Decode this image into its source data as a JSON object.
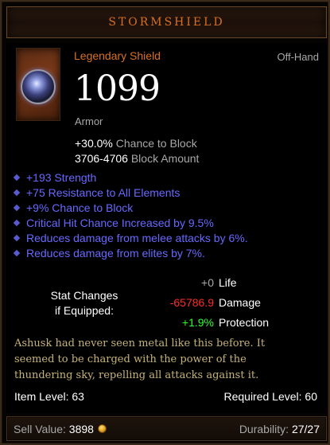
{
  "header": {
    "title": "STORMSHIELD"
  },
  "item": {
    "rarity_type": "Legendary Shield",
    "slot": "Off-Hand",
    "armor_value": "1099",
    "armor_label": "Armor",
    "block_chance_value": "+30.0%",
    "block_chance_label": "Chance to Block",
    "block_amount_value": "3706-4706",
    "block_amount_label": "Block Amount"
  },
  "affixes": [
    "+193 Strength",
    "+75 Resistance to All Elements",
    "+9% Chance to Block",
    "Critical Hit Chance Increased by 9.5%",
    "Reduces damage from melee attacks by 6%.",
    "Reduces damage from elites by 7%."
  ],
  "stat_changes": {
    "label_line1": "Stat Changes",
    "label_line2": "if Equipped:",
    "rows": [
      {
        "value": "+0",
        "name": "Life",
        "color": "#a8a8a8"
      },
      {
        "value": "-65786.9",
        "name": "Damage",
        "color": "#ff2a2a"
      },
      {
        "value": "+1.9%",
        "name": "Protection",
        "color": "#2aff2a"
      }
    ]
  },
  "flavor": {
    "line1": "Ashusk had never seen metal like this before. It",
    "line2": "seemed to be charged with the power of the",
    "line3": "thundering sky, repelling all attacks against it."
  },
  "levels": {
    "item_level": "Item Level: 63",
    "required_level": "Required Level: 60"
  },
  "footer": {
    "sell_label": "Sell Value:",
    "sell_value": "3898",
    "durability_label": "Durability:",
    "durability_value": "27/27"
  },
  "colors": {
    "title": "#d9701f",
    "legendary": "#d9701f",
    "magic_affix": "#6868ff",
    "flavor": "#c7b377",
    "negative": "#ff2a2a",
    "positive": "#2aff2a"
  },
  "icons": {
    "item": "shield-icon",
    "currency": "gold-coin-icon",
    "affix_bullet": "diamond-bullet-icon"
  }
}
